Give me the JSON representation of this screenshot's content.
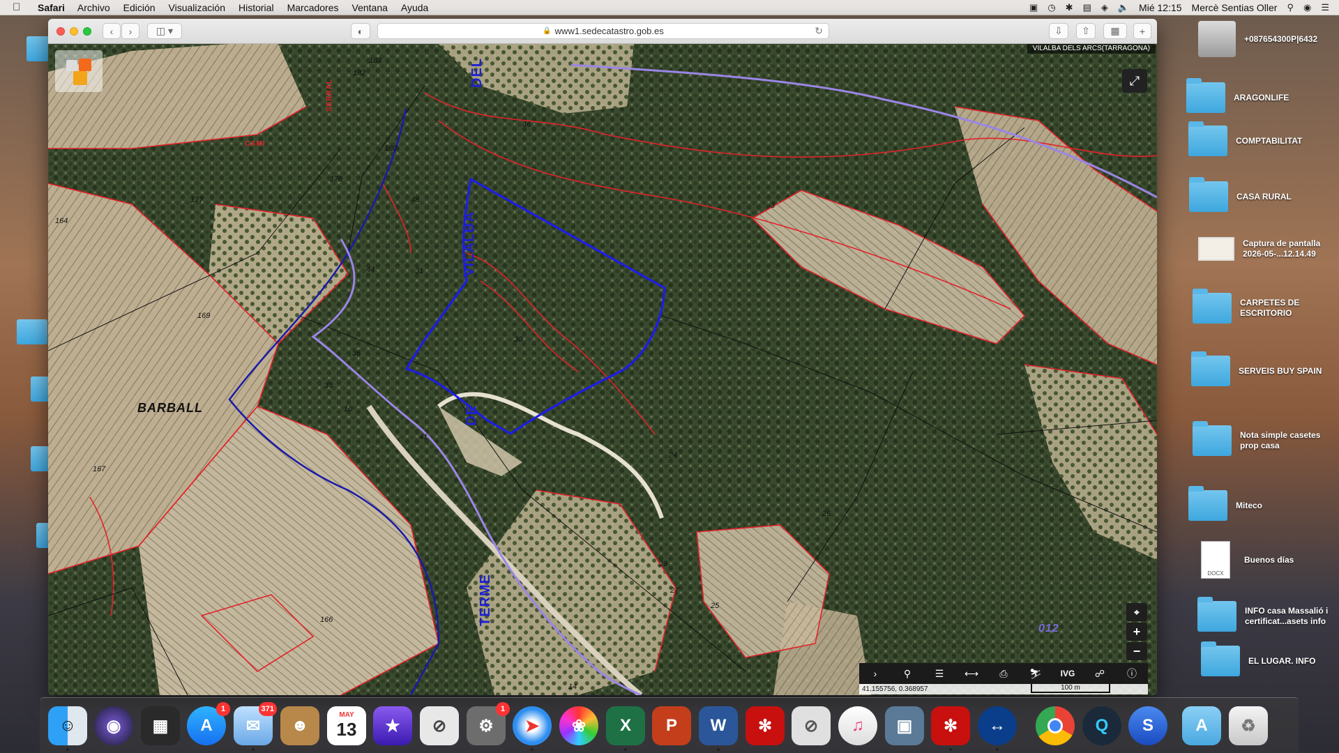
{
  "menubar": {
    "app_name": "Safari",
    "menus": [
      "Archivo",
      "Edición",
      "Visualización",
      "Historial",
      "Marcadores",
      "Ventana",
      "Ayuda"
    ],
    "clock": "Mié 12:15",
    "user": "Mercè Sentias Oller"
  },
  "browser": {
    "url": "www1.sedecatastro.gob.es"
  },
  "map": {
    "municipality_label": "VILALBA DELS ARCS(TARRAGONA)",
    "labels": {
      "barball": "BARBALL",
      "vilalba": "VILALBA",
      "del": "DEL",
      "de": "DE",
      "terme": "TERME",
      "camp": "CAMI",
      "serral": "SERRAL",
      "code": "012"
    },
    "parcel_numbers": [
      "183",
      "182",
      "46",
      "180",
      "178",
      "177",
      "164",
      "48",
      "44",
      "169",
      "31",
      "30",
      "36",
      "33",
      "10",
      "41",
      "167",
      "28",
      "25",
      "27",
      "26",
      "24",
      "166",
      "14",
      "3"
    ],
    "coordinates": "41.155756, 0.368957",
    "scale": "100 m",
    "toolbar_ivg": "IVG"
  },
  "desktop": {
    "drive_label": "+087654300P|6432",
    "items": [
      {
        "label": "ARAGONLIFE"
      },
      {
        "label": "COMPTABILITAT"
      },
      {
        "label": "CASA RURAL"
      },
      {
        "label": "Captura de pantalla 2026-05-...12.14.49"
      },
      {
        "label": "CARPETES DE ESCRITORIO"
      },
      {
        "label": "SERVEIS BUY SPAIN"
      },
      {
        "label": "Nota simple casetes prop casa"
      },
      {
        "label": "Miteco"
      },
      {
        "label": "Buenos días"
      },
      {
        "label": "INFO casa Massalió i certificat...asets info"
      },
      {
        "label": "EL LUGAR. INFO"
      }
    ],
    "docx_tag": "DOCX"
  },
  "dock": {
    "calendar_month": "MAY",
    "calendar_day": "13",
    "appstore_badge": "1",
    "mail_badge": "371",
    "prefs_badge": "1",
    "excel_letter": "X",
    "powerpoint_letter": "P",
    "word_letter": "W"
  }
}
